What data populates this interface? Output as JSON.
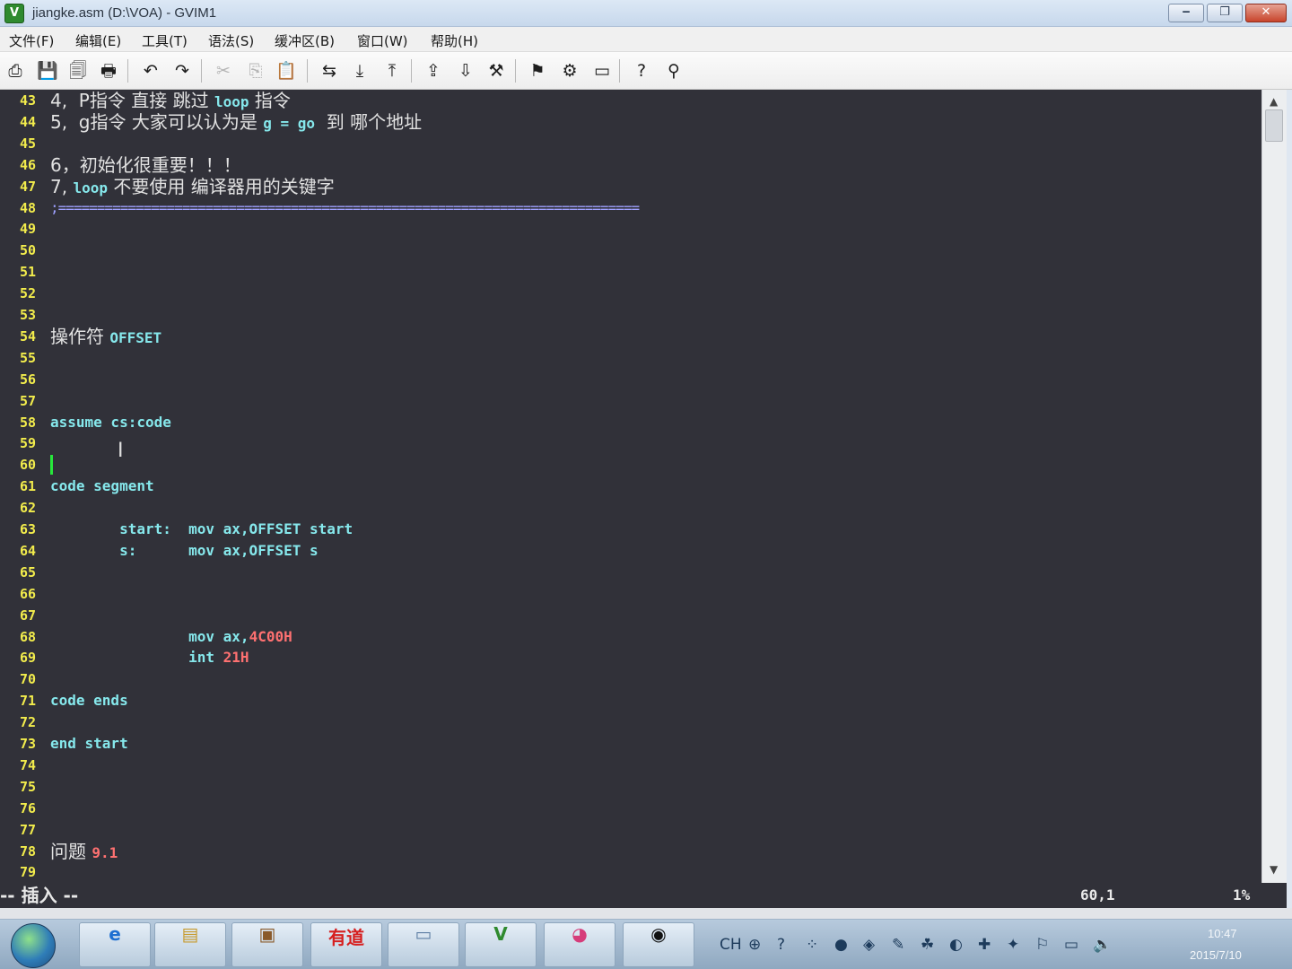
{
  "window": {
    "title": "jiangke.asm (D:\\VOA) - GVIM1",
    "app_icon": "vim-icon",
    "controls": {
      "minimize": "‒",
      "maximize": "❐",
      "close": "✕"
    }
  },
  "menu": [
    "文件(F)",
    "编辑(E)",
    "工具(T)",
    "语法(S)",
    "缓冲区(B)",
    "窗口(W)",
    "帮助(H)"
  ],
  "toolbar": [
    {
      "name": "open-icon",
      "glyph": "⎙"
    },
    {
      "name": "save-icon",
      "glyph": "💾"
    },
    {
      "name": "save-all-icon",
      "glyph": "🗐"
    },
    {
      "name": "print-icon",
      "glyph": "🖶"
    },
    {
      "name": "undo-icon",
      "glyph": "↶"
    },
    {
      "name": "redo-icon",
      "glyph": "↷"
    },
    {
      "name": "cut-icon",
      "glyph": "✂"
    },
    {
      "name": "copy-icon",
      "glyph": "⎘"
    },
    {
      "name": "paste-icon",
      "glyph": "📋"
    },
    {
      "name": "replace-icon",
      "glyph": "⇆"
    },
    {
      "name": "find-next-icon",
      "glyph": "⤓"
    },
    {
      "name": "find-prev-icon",
      "glyph": "⤒"
    },
    {
      "name": "load-session-icon",
      "glyph": "⇪"
    },
    {
      "name": "save-session-icon",
      "glyph": "⇩"
    },
    {
      "name": "run-script-icon",
      "glyph": "⚒"
    },
    {
      "name": "make-icon",
      "glyph": "⚑"
    },
    {
      "name": "shell-icon",
      "glyph": "⚙"
    },
    {
      "name": "tag-jump-icon",
      "glyph": "▭"
    },
    {
      "name": "help-icon",
      "glyph": "?"
    },
    {
      "name": "find-help-icon",
      "glyph": "⚲"
    }
  ],
  "editor": {
    "lines": [
      {
        "n": "43",
        "segs": [
          {
            "t": "4,  ",
            "c": "cm"
          },
          {
            "t": "P指令 直接 跳过 ",
            "c": "cm"
          },
          {
            "t": "loop",
            "c": "kw"
          },
          {
            "t": " 指令",
            "c": "cm"
          }
        ]
      },
      {
        "n": "44",
        "segs": [
          {
            "t": "5,  ",
            "c": "cm"
          },
          {
            "t": "g指令 大家可以认为是 ",
            "c": "cm"
          },
          {
            "t": "g = go",
            "c": "kw"
          },
          {
            "t": "  到 哪个地址",
            "c": "cm"
          }
        ]
      },
      {
        "n": "45",
        "segs": []
      },
      {
        "n": "46",
        "segs": [
          {
            "t": "6，初始化很重要！！！",
            "c": "cm"
          }
        ]
      },
      {
        "n": "47",
        "segs": [
          {
            "t": "7, ",
            "c": "cm"
          },
          {
            "t": "loop",
            "c": "kw"
          },
          {
            "t": " 不要使用 编译器用的关键字",
            "c": "cm"
          }
        ]
      },
      {
        "n": "48",
        "segs": [
          {
            "t": ";===========================================================================",
            "c": "dash"
          }
        ]
      },
      {
        "n": "49",
        "segs": []
      },
      {
        "n": "50",
        "segs": []
      },
      {
        "n": "51",
        "segs": []
      },
      {
        "n": "52",
        "segs": []
      },
      {
        "n": "53",
        "segs": []
      },
      {
        "n": "54",
        "segs": [
          {
            "t": "操作符 ",
            "c": "cm"
          },
          {
            "t": "OFFSET",
            "c": "kw"
          }
        ]
      },
      {
        "n": "55",
        "segs": []
      },
      {
        "n": "56",
        "segs": []
      },
      {
        "n": "57",
        "segs": []
      },
      {
        "n": "58",
        "segs": [
          {
            "t": "assume cs:code",
            "c": "kw"
          }
        ]
      },
      {
        "n": "59",
        "segs": []
      },
      {
        "n": "60",
        "segs": []
      },
      {
        "n": "61",
        "segs": [
          {
            "t": "code segment",
            "c": "kw"
          }
        ]
      },
      {
        "n": "62",
        "segs": []
      },
      {
        "n": "63",
        "segs": [
          {
            "t": "        start:  mov ax,OFFSET start",
            "c": "kw"
          }
        ]
      },
      {
        "n": "64",
        "segs": [
          {
            "t": "        s:      mov ax,OFFSET s",
            "c": "kw"
          }
        ]
      },
      {
        "n": "65",
        "segs": []
      },
      {
        "n": "66",
        "segs": []
      },
      {
        "n": "67",
        "segs": []
      },
      {
        "n": "68",
        "segs": [
          {
            "t": "                mov ax,",
            "c": "kw"
          },
          {
            "t": "4C00H",
            "c": "num"
          }
        ]
      },
      {
        "n": "69",
        "segs": [
          {
            "t": "                int ",
            "c": "kw"
          },
          {
            "t": "21H",
            "c": "num"
          }
        ]
      },
      {
        "n": "70",
        "segs": []
      },
      {
        "n": "71",
        "segs": [
          {
            "t": "code ends",
            "c": "kw"
          }
        ]
      },
      {
        "n": "72",
        "segs": []
      },
      {
        "n": "73",
        "segs": [
          {
            "t": "end start",
            "c": "kw"
          }
        ]
      },
      {
        "n": "74",
        "segs": []
      },
      {
        "n": "75",
        "segs": []
      },
      {
        "n": "76",
        "segs": []
      },
      {
        "n": "77",
        "segs": []
      },
      {
        "n": "78",
        "segs": [
          {
            "t": "问题 ",
            "c": "cm"
          },
          {
            "t": "9.1",
            "c": "num"
          }
        ]
      },
      {
        "n": "79",
        "segs": []
      }
    ]
  },
  "statusbar": {
    "mode": "-- 插入 --",
    "position": "60,1",
    "percent": "1%"
  },
  "taskbar": {
    "apps": [
      {
        "name": "ie-icon",
        "label": "e",
        "color": "#1e6fd1"
      },
      {
        "name": "explorer-icon",
        "label": "▤",
        "color": "#c79a2c"
      },
      {
        "name": "app-icon-brown",
        "label": "▣",
        "color": "#8a5a2a"
      },
      {
        "name": "youdao-icon",
        "label": "有道",
        "color": "#d61f1f"
      },
      {
        "name": "app-icon-window",
        "label": "▭",
        "color": "#5d7ea4"
      },
      {
        "name": "gvim-taskbar-icon",
        "label": "V",
        "color": "#2f8a2f"
      },
      {
        "name": "color-wheel-icon",
        "label": "◕",
        "color": "#d63c7a"
      },
      {
        "name": "obs-icon",
        "label": "◉",
        "color": "#111111"
      }
    ],
    "tray": [
      "CH",
      "⊕",
      "?",
      "⁘",
      "●",
      "◈",
      "✎",
      "☘",
      "◐",
      "✚",
      "✦",
      "⚐",
      "▭",
      "🔈"
    ],
    "clock_time": "10:47",
    "clock_date": "2015/7/10"
  }
}
